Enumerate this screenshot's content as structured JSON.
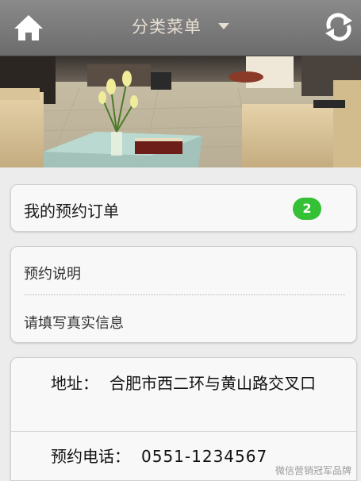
{
  "header": {
    "title": "分类菜单",
    "home_icon": "home-icon",
    "dropdown_icon": "caret-down-icon",
    "refresh_icon": "refresh-icon",
    "bar_color": "#7a7a7a",
    "title_color": "#e7ded2"
  },
  "banner": {
    "image": "hotel-lobby-photo"
  },
  "orders": {
    "label": "我的预约订单",
    "count": "2",
    "badge_color": "#35c135"
  },
  "info": {
    "items": [
      {
        "label": "预约说明"
      },
      {
        "label": "请填写真实信息"
      }
    ]
  },
  "contact": {
    "address_label": "地址：",
    "address_value": "合肥市西二环与黄山路交叉口",
    "phone_label": "预约电话：",
    "phone_value": "0551-1234567"
  },
  "watermark": {
    "text": "微信营销冠军品牌"
  }
}
